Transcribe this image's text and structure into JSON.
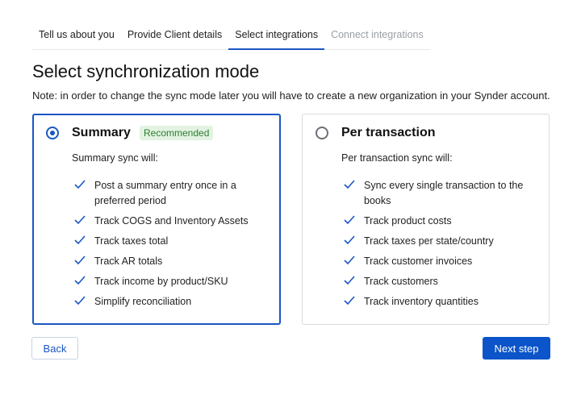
{
  "tabs": [
    {
      "label": "Tell us about you",
      "state": "done"
    },
    {
      "label": "Provide Client details",
      "state": "done"
    },
    {
      "label": "Select integrations",
      "state": "active"
    },
    {
      "label": "Connect integrations",
      "state": "disabled"
    }
  ],
  "page": {
    "title": "Select synchronization mode",
    "note": "Note: in order to change the sync mode later you will have to create a new organization in your Synder account."
  },
  "options": [
    {
      "title": "Summary",
      "badge": "Recommended",
      "selected": true,
      "subtitle": "Summary sync will:",
      "features": [
        "Post a summary entry once in a preferred period",
        "Track COGS and Inventory Assets",
        "Track taxes total",
        "Track AR totals",
        "Track income by product/SKU",
        "Simplify reconciliation"
      ]
    },
    {
      "title": "Per transaction",
      "selected": false,
      "subtitle": "Per transaction sync will:",
      "features": [
        "Sync every single transaction to the books",
        "Track product costs",
        "Track taxes per state/country",
        "Track customer invoices",
        "Track customers",
        "Track inventory quantities"
      ]
    }
  ],
  "actions": {
    "back_label": "Back",
    "next_label": "Next step"
  },
  "colors": {
    "accent": "#1a56c4",
    "primary_button": "#0b54c9",
    "badge_bg": "#e3f3e2",
    "badge_text": "#2e7d32",
    "check": "#1a56c4"
  },
  "icons": {
    "feature_bullet": "checkmark-icon"
  }
}
